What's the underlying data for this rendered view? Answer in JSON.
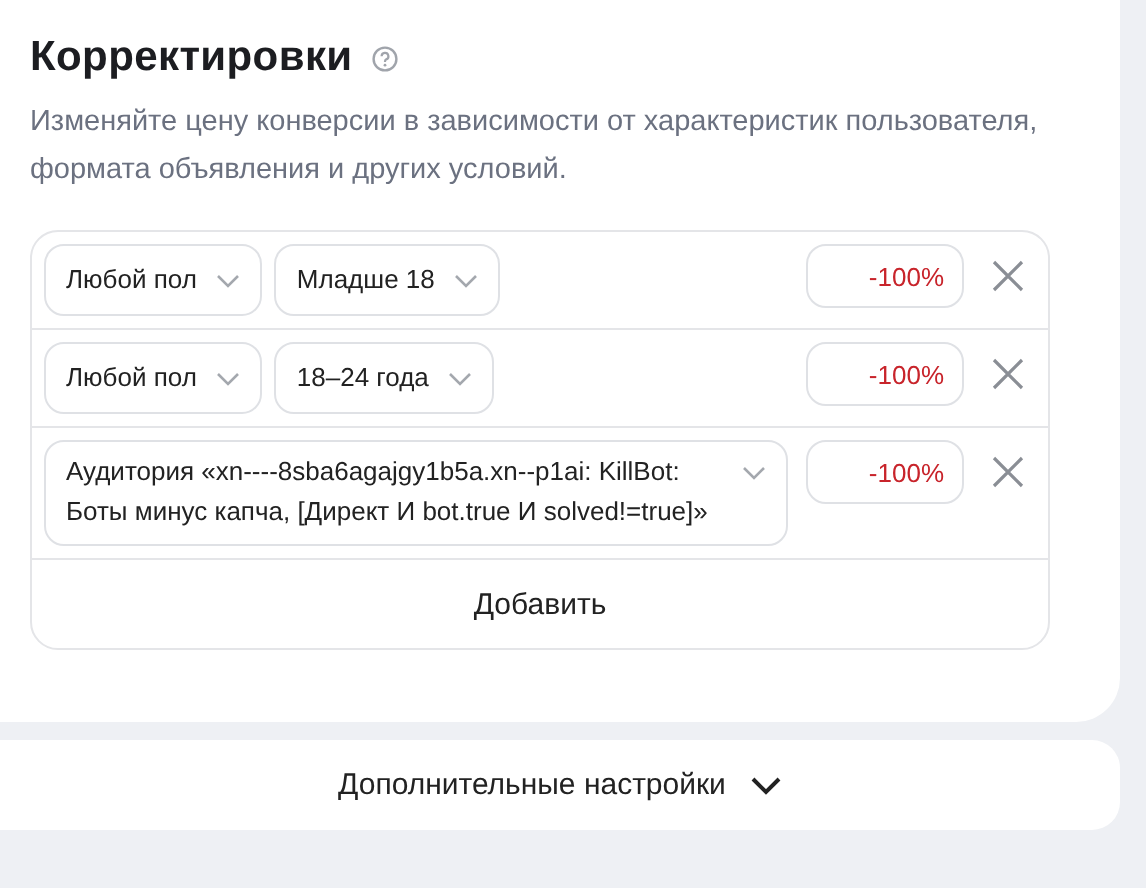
{
  "title": "Корректировки",
  "description": "Изменяйте цену конверсии в зависимости от характеристик пользователя, формата объявления и других условий.",
  "rows": [
    {
      "selects": [
        "Любой пол",
        "Младше 18"
      ],
      "value": "-100%"
    },
    {
      "selects": [
        "Любой пол",
        "18–24 года"
      ],
      "value": "-100%"
    },
    {
      "selects": [
        "Аудитория «xn----8sba6agajgy1b5a.xn--p1ai: KillBot: Боты минус капча, [Директ И bot.true И solved!=true]»"
      ],
      "value": "-100%"
    }
  ],
  "add_button": "Добавить",
  "more_settings": {
    "label": "Дополнительные настройки",
    "expanded": false
  }
}
